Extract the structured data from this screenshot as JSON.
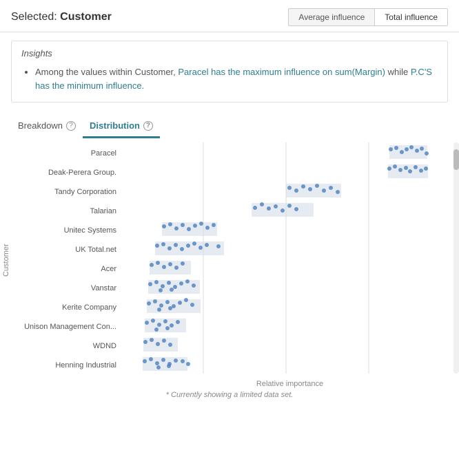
{
  "header": {
    "title_prefix": "Selected: ",
    "title_value": "Customer",
    "toggle_avg": "Average influence",
    "toggle_total": "Total influence"
  },
  "insights": {
    "label": "Insights",
    "text_part1": "Among the values within Customer, ",
    "text_highlight1": "Paracel has the maximum influence on sum(Margin)",
    "text_part2": " while ",
    "text_highlight2": "P.C'S has the minimum influence.",
    "text_end": ""
  },
  "tabs": [
    {
      "label": "Breakdown",
      "active": false
    },
    {
      "label": "Distribution",
      "active": true
    }
  ],
  "chart": {
    "y_axis_label": "Customer",
    "x_axis_label": "Relative importance",
    "footnote": "* Currently showing a limited data set.",
    "rows": [
      {
        "name": "Paracel"
      },
      {
        "name": "Deak-Perera Group."
      },
      {
        "name": "Tandy Corporation"
      },
      {
        "name": "Talarian"
      },
      {
        "name": "Unitec Systems"
      },
      {
        "name": "UK Total.net"
      },
      {
        "name": "Acer"
      },
      {
        "name": "Vanstar"
      },
      {
        "name": "Kerite Company"
      },
      {
        "name": "Unison Management Con..."
      },
      {
        "name": "WDND"
      },
      {
        "name": "Henning Industrial"
      }
    ]
  }
}
